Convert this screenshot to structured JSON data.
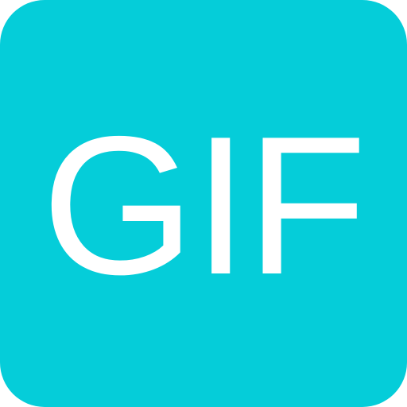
{
  "icon": {
    "name": "gif-icon",
    "label": "GIF",
    "background_color": "#05CDD9",
    "text_color": "#FFFFFF"
  }
}
